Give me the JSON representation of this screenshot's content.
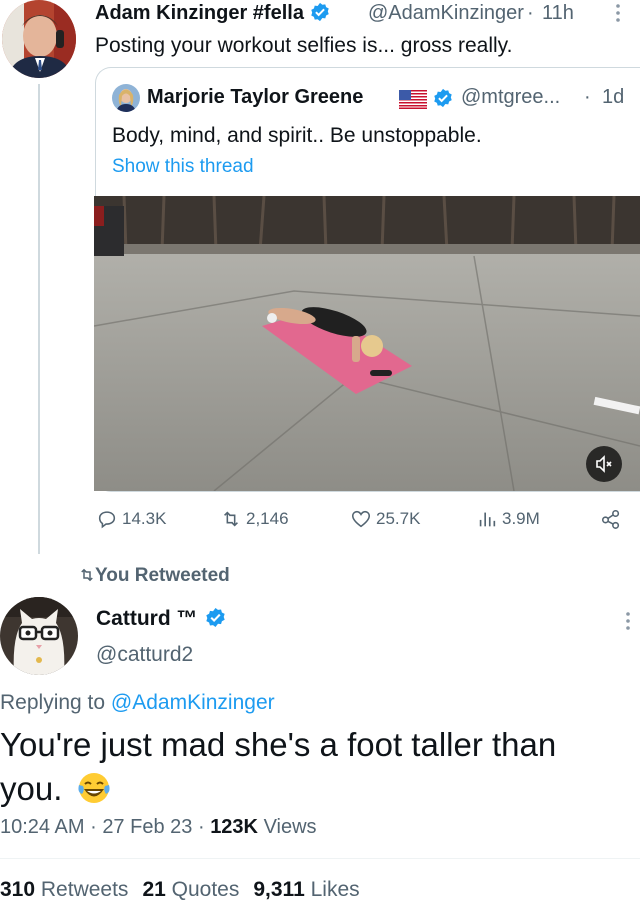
{
  "top_tweet": {
    "name": "Adam Kinzinger #fella",
    "handle": "@AdamKinzinger",
    "sep": "·",
    "time": "11h",
    "text": "Posting your workout selfies is... gross really.",
    "quoted": {
      "name": "Marjorie Taylor Greene",
      "handle": "@mtgree...",
      "sep": "·",
      "time": "1d",
      "text": "Body, mind, and spirit.. Be unstoppable.",
      "show_thread": "Show this thread"
    },
    "actions": {
      "replies": "14.3K",
      "retweets": "2,146",
      "likes": "25.7K",
      "views": "3.9M"
    }
  },
  "retweet_label": "You Retweeted",
  "main_tweet": {
    "name": "Catturd ™",
    "handle": "@catturd2",
    "replying_prefix": "Replying to ",
    "replying_mention": "@AdamKinzinger",
    "text": "You're just mad she's a foot taller than you.",
    "time": "10:24 AM",
    "date": "27 Feb 23",
    "views_count": "123K",
    "views_label": "Views",
    "meta_sep": "·",
    "stats": {
      "retweets_count": "310",
      "retweets_label": "Retweets",
      "quotes_count": "21",
      "quotes_label": "Quotes",
      "likes_count": "9,311",
      "likes_label": "Likes"
    }
  },
  "colors": {
    "accent": "#1d9bf0",
    "secondary_text": "#536471",
    "primary_text": "#0f1419",
    "border": "#cfd9de"
  },
  "icons": [
    "verified-badge-icon",
    "more-icon",
    "us-flag-icon",
    "mute-icon",
    "reply-icon",
    "retweet-icon",
    "like-icon",
    "views-icon",
    "share-icon",
    "laughing-tears-emoji"
  ]
}
